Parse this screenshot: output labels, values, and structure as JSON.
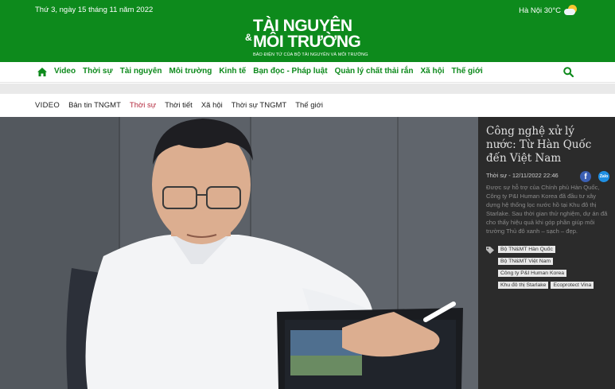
{
  "header": {
    "date": "Thứ 3, ngày 15 tháng 11 năm 2022",
    "weather": "Hà Nội 30°C",
    "logo_line1": "TÀI NGUYÊN",
    "logo_line2": "MÔI TRƯỜNG",
    "logo_sub": "BÁO ĐIỆN TỬ CỦA BỘ TÀI NGUYÊN VÀ MÔI TRƯỜNG",
    "brand_color": "#0d8a1c"
  },
  "main_nav": {
    "items": [
      "Video",
      "Thời sự",
      "Tài nguyên",
      "Môi trường",
      "Kinh tế",
      "Bạn đọc - Pháp luật",
      "Quản lý chất thải rắn",
      "Xã hội",
      "Thế giới"
    ]
  },
  "sub_nav": {
    "items": [
      "VIDEO",
      "Bản tin TNGMT",
      "Thời sự",
      "Thời tiết",
      "Xã hội",
      "Thời sự TNGMT",
      "Thế giới"
    ],
    "active": "Thời sự"
  },
  "article": {
    "title": "Công nghệ xử lý nước: Từ Hàn Quốc đến Việt Nam",
    "meta": "Thời sự - 12/11/2022 22:46",
    "description": "Được sự hỗ trợ của Chính phủ Hàn Quốc, Công ty P&I Human Korea đã đầu tư xây dựng hệ thống lọc nước hồ tại Khu đô thị Starlake. Sau thời gian thử nghiệm, dự án đã cho thấy hiệu quả khi góp phần giúp môi trường Thủ đô xanh – sạch – đẹp.",
    "tags": [
      "Bộ TN&MT Hàn Quốc",
      "Bộ TN&MT Việt Nam",
      "Công ty P&I Human Korea",
      "Khu đô thị Starlake",
      "Ecoprotect Vina"
    ]
  }
}
